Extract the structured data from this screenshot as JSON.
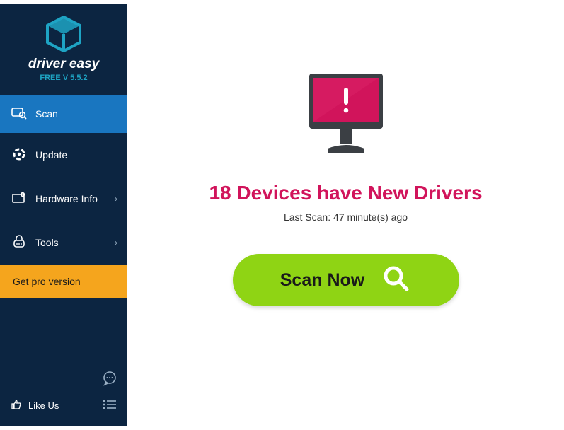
{
  "window": {
    "minimize": "—",
    "close": "✕"
  },
  "brand": {
    "name": "driver easy",
    "version": "FREE V 5.5.2"
  },
  "sidebar": {
    "scan": "Scan",
    "update": "Update",
    "hardware": "Hardware Info",
    "tools": "Tools",
    "upgrade": "Get pro version",
    "likeus": "Like Us"
  },
  "main": {
    "headline": "18 Devices have New Drivers",
    "lastscan": "Last Scan: 47 minute(s) ago",
    "scan_button": "Scan Now"
  }
}
